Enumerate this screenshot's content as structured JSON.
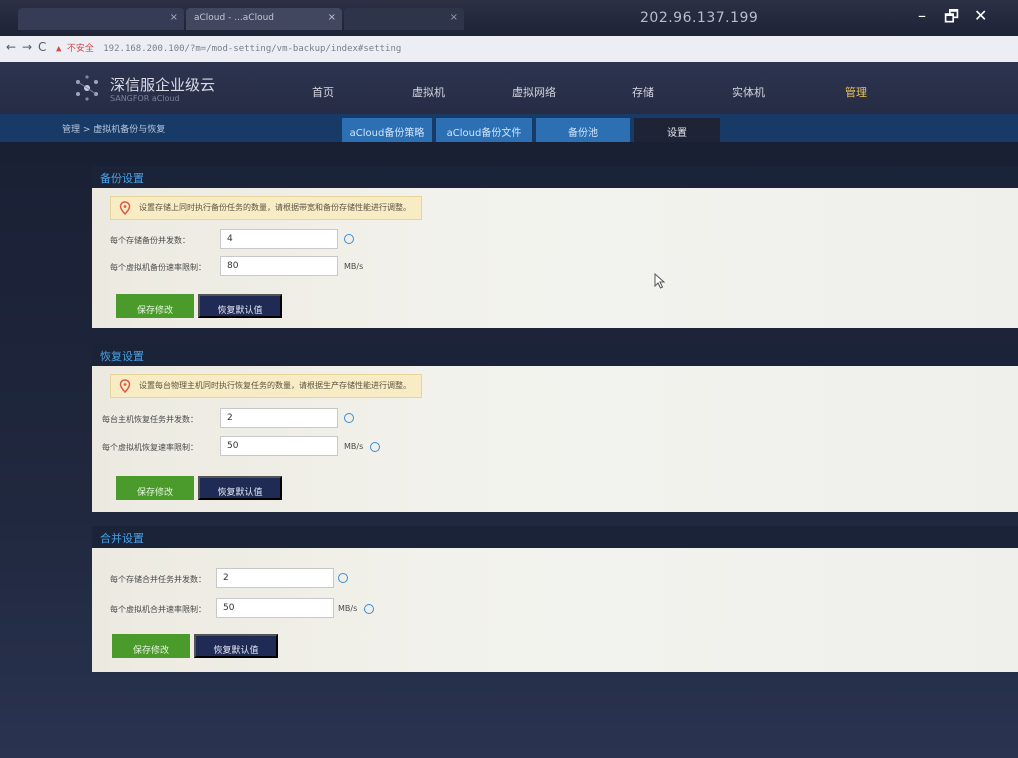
{
  "browser": {
    "tabs": [
      {
        "label": "",
        "close": "×"
      },
      {
        "label": "aCloud - ...aCloud",
        "close": "×"
      },
      {
        "label": "",
        "close": "×"
      }
    ],
    "remote_ip": "202.96.137.199",
    "window_buttons": {
      "minimize": "–",
      "restore": "🗗",
      "close": "✕"
    },
    "nav": {
      "back": "←",
      "forward": "→",
      "reload": "C"
    },
    "security_label": "▲ 不安全",
    "url": "192.168.200.100/?m=/mod-setting/vm-backup/index#setting"
  },
  "app": {
    "brand_name": "深信服企业级云",
    "brand_sub": "SANGFOR aCloud",
    "nav": [
      "首页",
      "虚拟机",
      "虚拟网络",
      "存储",
      "实体机",
      "管理"
    ],
    "breadcrumb": "管理 > 虚拟机备份与恢复",
    "subtabs": [
      "aCloud备份策略",
      "aCloud备份文件",
      "备份池",
      "设置"
    ],
    "active_subtab": "设置"
  },
  "sections": {
    "backup": {
      "title": "备份设置",
      "notice": "设置存储上同时执行备份任务的数量，请根据带宽和备份存储性能进行调整。",
      "fields": [
        {
          "label": "每个存储备份并发数：",
          "value": "4",
          "unit": ""
        },
        {
          "label": "每个虚拟机备份速率限制：",
          "value": "80",
          "unit": "MB/s"
        }
      ],
      "save": "保存修改",
      "reset": "恢复默认值"
    },
    "restore": {
      "title": "恢复设置",
      "notice": "设置每台物理主机同时执行恢复任务的数量，请根据生产存储性能进行调整。",
      "fields": [
        {
          "label": "每台主机恢复任务并发数：",
          "value": "2",
          "unit": ""
        },
        {
          "label": "每个虚拟机恢复速率限制：",
          "value": "50",
          "unit": "MB/s"
        }
      ],
      "save": "保存修改",
      "reset": "恢复默认值"
    },
    "merge": {
      "title": "合并设置",
      "fields": [
        {
          "label": "每个存储合并任务并发数：",
          "value": "2",
          "unit": ""
        },
        {
          "label": "每个虚拟机合并速率限制：",
          "value": "50",
          "unit": "MB/s"
        }
      ],
      "save": "保存修改",
      "reset": "恢复默认值"
    }
  },
  "colors": {
    "accent_blue": "#2c6fb2",
    "save_green": "#4a9a2c",
    "reset_navy": "#1f2b55",
    "section_title": "#4aa3e8"
  }
}
